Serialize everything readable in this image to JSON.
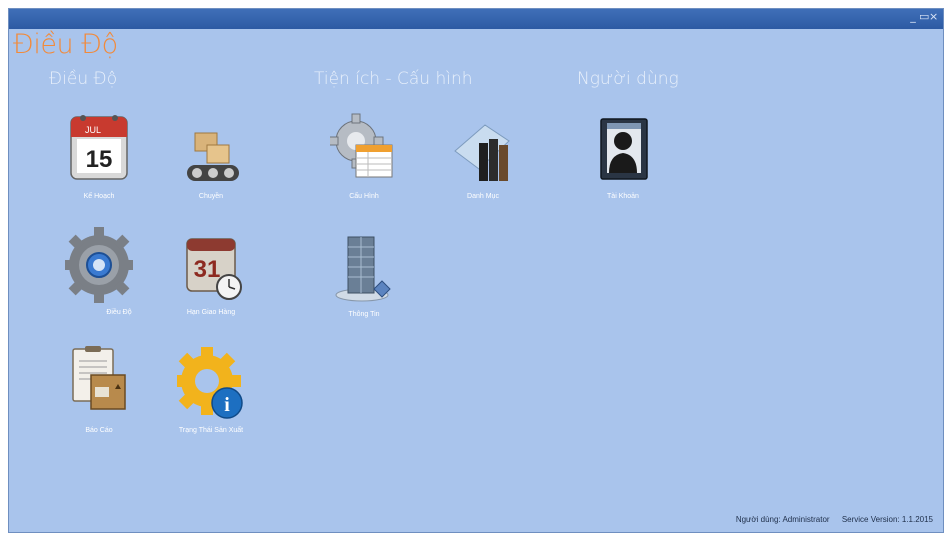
{
  "window": {
    "controls": [
      "_",
      "▭",
      "×"
    ]
  },
  "app": {
    "title": "Điều Độ"
  },
  "groups": [
    {
      "title": "Điều Độ"
    },
    {
      "title": "Tiện ích - Cấu hình"
    },
    {
      "title": "Người dùng"
    }
  ],
  "tiles": {
    "ke_hoach": {
      "label": "Kế Hoạch",
      "icon": "calendar-icon",
      "month": "JUL",
      "day": "15"
    },
    "chuyen": {
      "label": "Chuyền",
      "icon": "conveyor-icon"
    },
    "cau_hinh": {
      "label": "Cấu Hình",
      "icon": "settings-gear-icon"
    },
    "danh_muc": {
      "label": "Danh Mục",
      "icon": "books-icon"
    },
    "tai_khoan": {
      "label": "Tài Khoản",
      "icon": "user-account-icon"
    },
    "dieu_do": {
      "label": "Điều Độ",
      "icon": "gear-icon"
    },
    "han_giao_hang": {
      "label": "Hạn Giao Hàng",
      "icon": "deadline-calendar-icon",
      "day": "31"
    },
    "thong_tin": {
      "label": "Thông Tin",
      "icon": "building-info-icon"
    },
    "bao_cao": {
      "label": "Báo Cáo",
      "icon": "report-icon"
    },
    "trang_thai": {
      "label": "Trạng Thái Sản Xuất",
      "icon": "production-status-icon"
    }
  },
  "status_bar": {
    "user": "Người dùng: Administrator",
    "version": "Service Version: 1.1.2015"
  },
  "colors": {
    "background": "#a9c4ec",
    "titlebar": "#2d5aa3",
    "app_title": "#f28a3a"
  }
}
